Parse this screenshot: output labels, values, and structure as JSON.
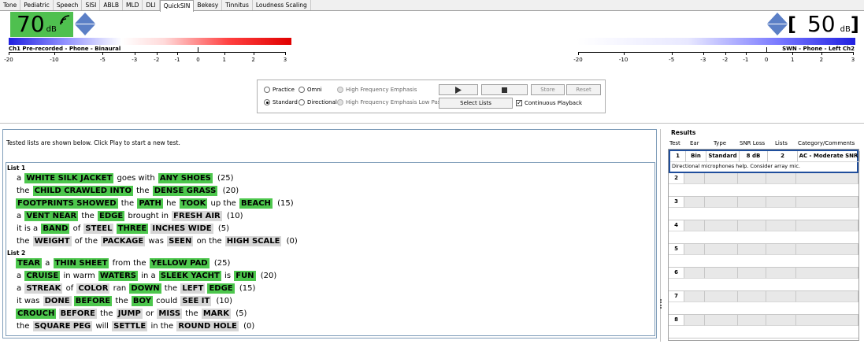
{
  "tabs": [
    "Tone",
    "Pediatric",
    "Speech",
    "SISI",
    "ABLB",
    "MLD",
    "DLI",
    "QuickSIN",
    "Bekesy",
    "Tinnitus",
    "Loudness Scaling"
  ],
  "active_tab": "QuickSIN",
  "left_channel": {
    "level": "70",
    "unit": "dB",
    "label": "Ch1  Pre-recorded - Phone - Binaural",
    "scale": [
      "-20",
      "-10",
      "-5",
      "-3",
      "-2",
      "-1",
      "0",
      "1",
      "2",
      "3"
    ]
  },
  "right_channel": {
    "bracket_open": "[",
    "bracket_close": "]",
    "level": "50",
    "unit": "dB",
    "label": "SWN - Phone - Left  Ch2",
    "scale": [
      "-20",
      "-10",
      "-5",
      "-3",
      "-2",
      "-1",
      "0",
      "1",
      "2",
      "3"
    ]
  },
  "controls": {
    "practice": "Practice",
    "standard": "Standard",
    "omni": "Omni",
    "directional": "Directional",
    "hfe": "High Frequency Emphasis",
    "hfe_lp": "High Frequency Emphasis Low Pass",
    "store": "Store",
    "reset": "Reset",
    "select_lists": "Select Lists",
    "continuous": "Continuous Playback",
    "selected_mode": "Standard",
    "continuous_checked": true
  },
  "status_text": "Tested lists are shown below. Click Play to start a new test.",
  "lists": [
    {
      "title": "List 1",
      "sentences": [
        {
          "tokens": [
            [
              "a",
              "w"
            ],
            [
              "WHITE SILK JACKET",
              "g"
            ],
            [
              "goes with",
              "w"
            ],
            [
              "ANY SHOES",
              "g"
            ]
          ],
          "score": "(25)"
        },
        {
          "tokens": [
            [
              "the",
              "w"
            ],
            [
              "CHILD CRAWLED INTO",
              "g"
            ],
            [
              "the",
              "w"
            ],
            [
              "DENSE GRASS",
              "g"
            ]
          ],
          "score": "(20)"
        },
        {
          "tokens": [
            [
              "FOOTPRINTS SHOWED",
              "g"
            ],
            [
              "the",
              "w"
            ],
            [
              "PATH",
              "g"
            ],
            [
              "he",
              "w"
            ],
            [
              "TOOK",
              "g"
            ],
            [
              "up the",
              "w"
            ],
            [
              "BEACH",
              "g"
            ]
          ],
          "score": "(15)"
        },
        {
          "tokens": [
            [
              "a",
              "w"
            ],
            [
              "VENT NEAR",
              "g"
            ],
            [
              "the",
              "w"
            ],
            [
              "EDGE",
              "g"
            ],
            [
              "brought in",
              "w"
            ],
            [
              "FRESH AIR",
              "n"
            ]
          ],
          "score": "(10)"
        },
        {
          "tokens": [
            [
              "it is a",
              "w"
            ],
            [
              "BAND",
              "g"
            ],
            [
              "of",
              "w"
            ],
            [
              "STEEL",
              "n"
            ],
            [
              "THREE",
              "g"
            ],
            [
              "INCHES WIDE",
              "n"
            ]
          ],
          "score": "(5)"
        },
        {
          "tokens": [
            [
              "the",
              "w"
            ],
            [
              "WEIGHT",
              "n"
            ],
            [
              "of the",
              "w"
            ],
            [
              "PACKAGE",
              "n"
            ],
            [
              "was",
              "w"
            ],
            [
              "SEEN",
              "n"
            ],
            [
              "on the",
              "w"
            ],
            [
              "HIGH SCALE",
              "n"
            ]
          ],
          "score": "(0)"
        }
      ]
    },
    {
      "title": "List 2",
      "sentences": [
        {
          "tokens": [
            [
              "TEAR",
              "g"
            ],
            [
              "a",
              "w"
            ],
            [
              "THIN SHEET",
              "g"
            ],
            [
              "from the",
              "w"
            ],
            [
              "YELLOW PAD",
              "g"
            ]
          ],
          "score": "(25)"
        },
        {
          "tokens": [
            [
              "a",
              "w"
            ],
            [
              "CRUISE",
              "g"
            ],
            [
              "in warm",
              "w"
            ],
            [
              "WATERS",
              "g"
            ],
            [
              "in a",
              "w"
            ],
            [
              "SLEEK YACHT",
              "g"
            ],
            [
              "is",
              "w"
            ],
            [
              "FUN",
              "g"
            ]
          ],
          "score": "(20)"
        },
        {
          "tokens": [
            [
              "a",
              "w"
            ],
            [
              "STREAK",
              "n"
            ],
            [
              "of",
              "w"
            ],
            [
              "COLOR",
              "n"
            ],
            [
              "ran",
              "w"
            ],
            [
              "DOWN",
              "g"
            ],
            [
              "the",
              "w"
            ],
            [
              "LEFT",
              "n"
            ],
            [
              "EDGE",
              "g"
            ]
          ],
          "score": "(15)"
        },
        {
          "tokens": [
            [
              "it was",
              "w"
            ],
            [
              "DONE",
              "n"
            ],
            [
              "BEFORE",
              "g"
            ],
            [
              "the",
              "w"
            ],
            [
              "BOY",
              "g"
            ],
            [
              "could",
              "w"
            ],
            [
              "SEE IT",
              "n"
            ]
          ],
          "score": "(10)"
        },
        {
          "tokens": [
            [
              "CROUCH",
              "g"
            ],
            [
              "BEFORE",
              "n"
            ],
            [
              "the",
              "w"
            ],
            [
              "JUMP",
              "n"
            ],
            [
              "or",
              "w"
            ],
            [
              "MISS",
              "n"
            ],
            [
              "the",
              "w"
            ],
            [
              "MARK",
              "n"
            ]
          ],
          "score": "(5)"
        },
        {
          "tokens": [
            [
              "the",
              "w"
            ],
            [
              "SQUARE PEG",
              "n"
            ],
            [
              "will",
              "w"
            ],
            [
              "SETTLE",
              "n"
            ],
            [
              "in the",
              "w"
            ],
            [
              "ROUND HOLE",
              "n"
            ]
          ],
          "score": "(0)"
        }
      ]
    }
  ],
  "results": {
    "title": "Results",
    "headers": [
      "Test",
      "Ear",
      "Type",
      "SNR Loss",
      "Lists",
      "Category/Comments"
    ],
    "rows": [
      {
        "test": "1",
        "ear": "Bin",
        "type": "Standard",
        "snr": "8 dB",
        "lists": "2",
        "category": "AC - Moderate SNR",
        "comment": "Directional microphones help.  Consider array mic."
      },
      {
        "test": "2",
        "ear": "",
        "type": "",
        "snr": "",
        "lists": "",
        "category": "",
        "comment": ""
      },
      {
        "test": "3",
        "ear": "",
        "type": "",
        "snr": "",
        "lists": "",
        "category": "",
        "comment": ""
      },
      {
        "test": "4",
        "ear": "",
        "type": "",
        "snr": "",
        "lists": "",
        "category": "",
        "comment": ""
      },
      {
        "test": "5",
        "ear": "",
        "type": "",
        "snr": "",
        "lists": "",
        "category": "",
        "comment": ""
      },
      {
        "test": "6",
        "ear": "",
        "type": "",
        "snr": "",
        "lists": "",
        "category": "",
        "comment": ""
      },
      {
        "test": "7",
        "ear": "",
        "type": "",
        "snr": "",
        "lists": "",
        "category": "",
        "comment": ""
      },
      {
        "test": "8",
        "ear": "",
        "type": "",
        "snr": "",
        "lists": "",
        "category": "",
        "comment": ""
      }
    ]
  }
}
